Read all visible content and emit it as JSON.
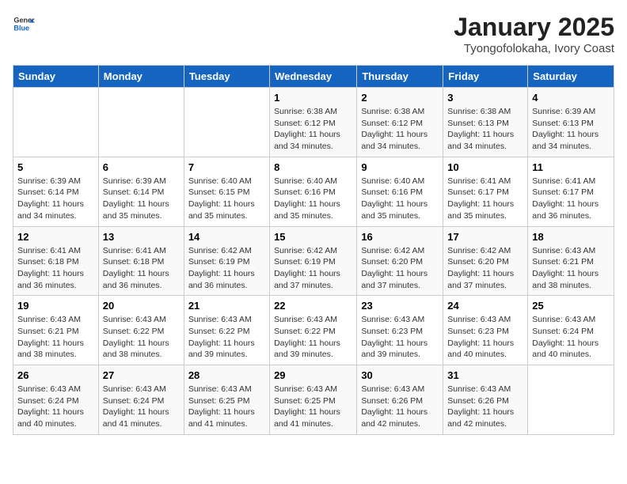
{
  "header": {
    "logo_general": "General",
    "logo_blue": "Blue",
    "title": "January 2025",
    "subtitle": "Tyongofolokaha, Ivory Coast"
  },
  "columns": [
    "Sunday",
    "Monday",
    "Tuesday",
    "Wednesday",
    "Thursday",
    "Friday",
    "Saturday"
  ],
  "rows": [
    [
      {
        "day": "",
        "info": ""
      },
      {
        "day": "",
        "info": ""
      },
      {
        "day": "",
        "info": ""
      },
      {
        "day": "1",
        "info": "Sunrise: 6:38 AM\nSunset: 6:12 PM\nDaylight: 11 hours and 34 minutes."
      },
      {
        "day": "2",
        "info": "Sunrise: 6:38 AM\nSunset: 6:12 PM\nDaylight: 11 hours and 34 minutes."
      },
      {
        "day": "3",
        "info": "Sunrise: 6:38 AM\nSunset: 6:13 PM\nDaylight: 11 hours and 34 minutes."
      },
      {
        "day": "4",
        "info": "Sunrise: 6:39 AM\nSunset: 6:13 PM\nDaylight: 11 hours and 34 minutes."
      }
    ],
    [
      {
        "day": "5",
        "info": "Sunrise: 6:39 AM\nSunset: 6:14 PM\nDaylight: 11 hours and 34 minutes."
      },
      {
        "day": "6",
        "info": "Sunrise: 6:39 AM\nSunset: 6:14 PM\nDaylight: 11 hours and 35 minutes."
      },
      {
        "day": "7",
        "info": "Sunrise: 6:40 AM\nSunset: 6:15 PM\nDaylight: 11 hours and 35 minutes."
      },
      {
        "day": "8",
        "info": "Sunrise: 6:40 AM\nSunset: 6:16 PM\nDaylight: 11 hours and 35 minutes."
      },
      {
        "day": "9",
        "info": "Sunrise: 6:40 AM\nSunset: 6:16 PM\nDaylight: 11 hours and 35 minutes."
      },
      {
        "day": "10",
        "info": "Sunrise: 6:41 AM\nSunset: 6:17 PM\nDaylight: 11 hours and 35 minutes."
      },
      {
        "day": "11",
        "info": "Sunrise: 6:41 AM\nSunset: 6:17 PM\nDaylight: 11 hours and 36 minutes."
      }
    ],
    [
      {
        "day": "12",
        "info": "Sunrise: 6:41 AM\nSunset: 6:18 PM\nDaylight: 11 hours and 36 minutes."
      },
      {
        "day": "13",
        "info": "Sunrise: 6:41 AM\nSunset: 6:18 PM\nDaylight: 11 hours and 36 minutes."
      },
      {
        "day": "14",
        "info": "Sunrise: 6:42 AM\nSunset: 6:19 PM\nDaylight: 11 hours and 36 minutes."
      },
      {
        "day": "15",
        "info": "Sunrise: 6:42 AM\nSunset: 6:19 PM\nDaylight: 11 hours and 37 minutes."
      },
      {
        "day": "16",
        "info": "Sunrise: 6:42 AM\nSunset: 6:20 PM\nDaylight: 11 hours and 37 minutes."
      },
      {
        "day": "17",
        "info": "Sunrise: 6:42 AM\nSunset: 6:20 PM\nDaylight: 11 hours and 37 minutes."
      },
      {
        "day": "18",
        "info": "Sunrise: 6:43 AM\nSunset: 6:21 PM\nDaylight: 11 hours and 38 minutes."
      }
    ],
    [
      {
        "day": "19",
        "info": "Sunrise: 6:43 AM\nSunset: 6:21 PM\nDaylight: 11 hours and 38 minutes."
      },
      {
        "day": "20",
        "info": "Sunrise: 6:43 AM\nSunset: 6:22 PM\nDaylight: 11 hours and 38 minutes."
      },
      {
        "day": "21",
        "info": "Sunrise: 6:43 AM\nSunset: 6:22 PM\nDaylight: 11 hours and 39 minutes."
      },
      {
        "day": "22",
        "info": "Sunrise: 6:43 AM\nSunset: 6:22 PM\nDaylight: 11 hours and 39 minutes."
      },
      {
        "day": "23",
        "info": "Sunrise: 6:43 AM\nSunset: 6:23 PM\nDaylight: 11 hours and 39 minutes."
      },
      {
        "day": "24",
        "info": "Sunrise: 6:43 AM\nSunset: 6:23 PM\nDaylight: 11 hours and 40 minutes."
      },
      {
        "day": "25",
        "info": "Sunrise: 6:43 AM\nSunset: 6:24 PM\nDaylight: 11 hours and 40 minutes."
      }
    ],
    [
      {
        "day": "26",
        "info": "Sunrise: 6:43 AM\nSunset: 6:24 PM\nDaylight: 11 hours and 40 minutes."
      },
      {
        "day": "27",
        "info": "Sunrise: 6:43 AM\nSunset: 6:24 PM\nDaylight: 11 hours and 41 minutes."
      },
      {
        "day": "28",
        "info": "Sunrise: 6:43 AM\nSunset: 6:25 PM\nDaylight: 11 hours and 41 minutes."
      },
      {
        "day": "29",
        "info": "Sunrise: 6:43 AM\nSunset: 6:25 PM\nDaylight: 11 hours and 41 minutes."
      },
      {
        "day": "30",
        "info": "Sunrise: 6:43 AM\nSunset: 6:26 PM\nDaylight: 11 hours and 42 minutes."
      },
      {
        "day": "31",
        "info": "Sunrise: 6:43 AM\nSunset: 6:26 PM\nDaylight: 11 hours and 42 minutes."
      },
      {
        "day": "",
        "info": ""
      }
    ]
  ]
}
